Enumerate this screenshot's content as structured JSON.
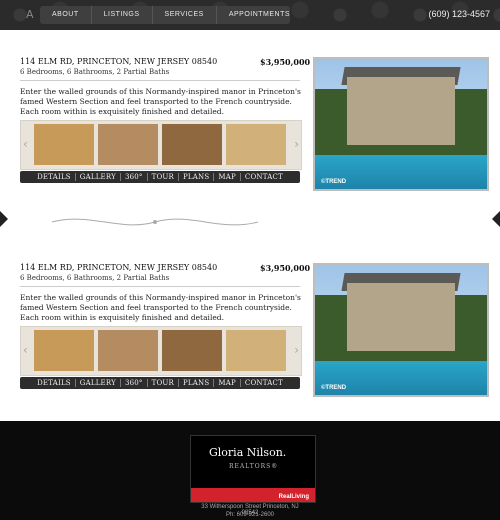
{
  "header": {
    "logo_glyph": "A",
    "nav": [
      "ABOUT",
      "LISTINGS",
      "SERVICES",
      "APPOINTMENTS"
    ],
    "phone": "(609) 123-4567"
  },
  "listings": [
    {
      "address": "114 ELM RD, PRINCETON, NEW JERSEY 08540",
      "price": "$3,950,000",
      "rooms": "6 Bedrooms, 6 Bathrooms, 2 Partial Baths",
      "description": "Enter the walled grounds of this Normandy-inspired manor in Princeton's famed Western Section and feel transported to the French countryside. Each room within is exquisitely finished and detailed.",
      "actions": [
        "DETAILS",
        "GALLERY",
        "360°",
        "TOUR",
        "PLANS",
        "MAP",
        "CONTACT"
      ],
      "photo_watermark": "©TREND"
    },
    {
      "address": "114 ELM RD, PRINCETON, NEW JERSEY 08540",
      "price": "$3,950,000",
      "rooms": "6 Bedrooms, 6 Bathrooms, 2 Partial Baths",
      "description": "Enter the walled grounds of this Normandy-inspired manor in Princeton's famed Western Section and feel transported to the French countryside. Each room within is exquisitely finished and detailed.",
      "actions": [
        "DETAILS",
        "GALLERY",
        "360°",
        "TOUR",
        "PLANS",
        "MAP",
        "CONTACT"
      ],
      "photo_watermark": "©TREND"
    }
  ],
  "footer": {
    "brand": "Gloria Nilson.",
    "tagline": "REALTORS®",
    "affiliate": "RealLiving",
    "address": "33 Witherspoon Street Princeton, NJ 08542",
    "phone": "Ph: 609-921-2600"
  },
  "colors": {
    "accent_red": "#d2222c",
    "bar_dark": "#2d2d2d"
  }
}
